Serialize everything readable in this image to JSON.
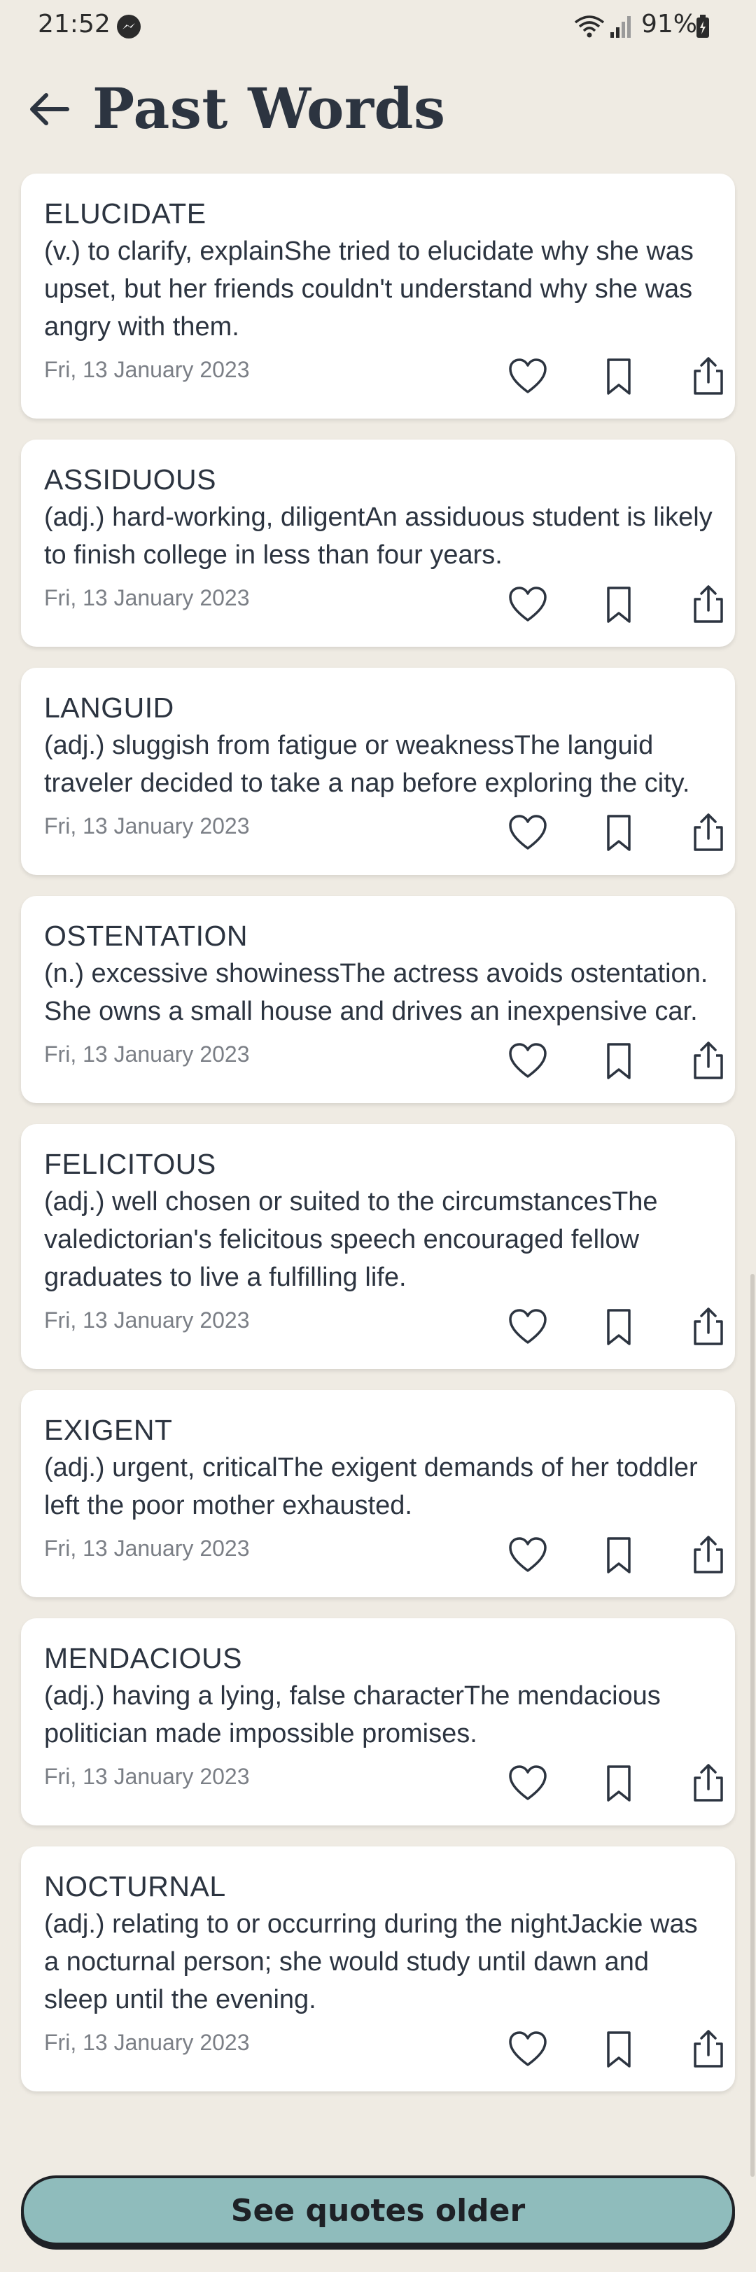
{
  "status_bar": {
    "time": "21:52",
    "battery": "91%",
    "icons": [
      "messenger-icon",
      "wifi-icon",
      "signal-icon",
      "battery-icon"
    ]
  },
  "header": {
    "title": "Past Words",
    "back_icon": "arrow-left-icon"
  },
  "colors": {
    "background": "#efebe3",
    "card": "#ffffff",
    "text": "#2c3440",
    "muted": "#7b7f86",
    "button": "#8fbcbc"
  },
  "entries": [
    {
      "word": "ELUCIDATE",
      "definition": "(v.) to clarify, explainShe tried to elucidate why she was upset, but her friends couldn't understand why she was angry with them.",
      "date": "Fri, 13 January 2023"
    },
    {
      "word": "ASSIDUOUS",
      "definition": "(adj.) hard-working, diligentAn assiduous student is likely to finish college in less than four years.",
      "date": "Fri, 13 January 2023"
    },
    {
      "word": "LANGUID",
      "definition": "(adj.) sluggish from fatigue or weaknessThe languid traveler decided to take a nap before exploring the city.",
      "date": "Fri, 13 January 2023"
    },
    {
      "word": "OSTENTATION",
      "definition": "(n.) excessive showinessThe actress avoids ostentation. She owns a small house and drives an inexpensive car.",
      "date": "Fri, 13 January 2023"
    },
    {
      "word": "FELICITOUS",
      "definition": "(adj.) well chosen or suited to the circumstancesThe valedictorian's felicitous speech encouraged fellow graduates to live a fulfilling life.",
      "date": "Fri, 13 January 2023"
    },
    {
      "word": "EXIGENT",
      "definition": "(adj.) urgent, criticalThe exigent demands of her toddler left the poor mother exhausted.",
      "date": "Fri, 13 January 2023"
    },
    {
      "word": "MENDACIOUS",
      "definition": "(adj.) having a lying, false characterThe mendacious politician made impossible promises.",
      "date": "Fri, 13 January 2023"
    },
    {
      "word": "NOCTURNAL",
      "definition": "(adj.) relating to or occurring during the nightJackie was a nocturnal person; she would study until dawn and sleep until the evening.",
      "date": "Fri, 13 January 2023"
    }
  ],
  "actions": {
    "like_icon": "heart-icon",
    "bookmark_icon": "bookmark-icon",
    "share_icon": "share-icon"
  },
  "footer": {
    "button_label": "See quotes older"
  }
}
